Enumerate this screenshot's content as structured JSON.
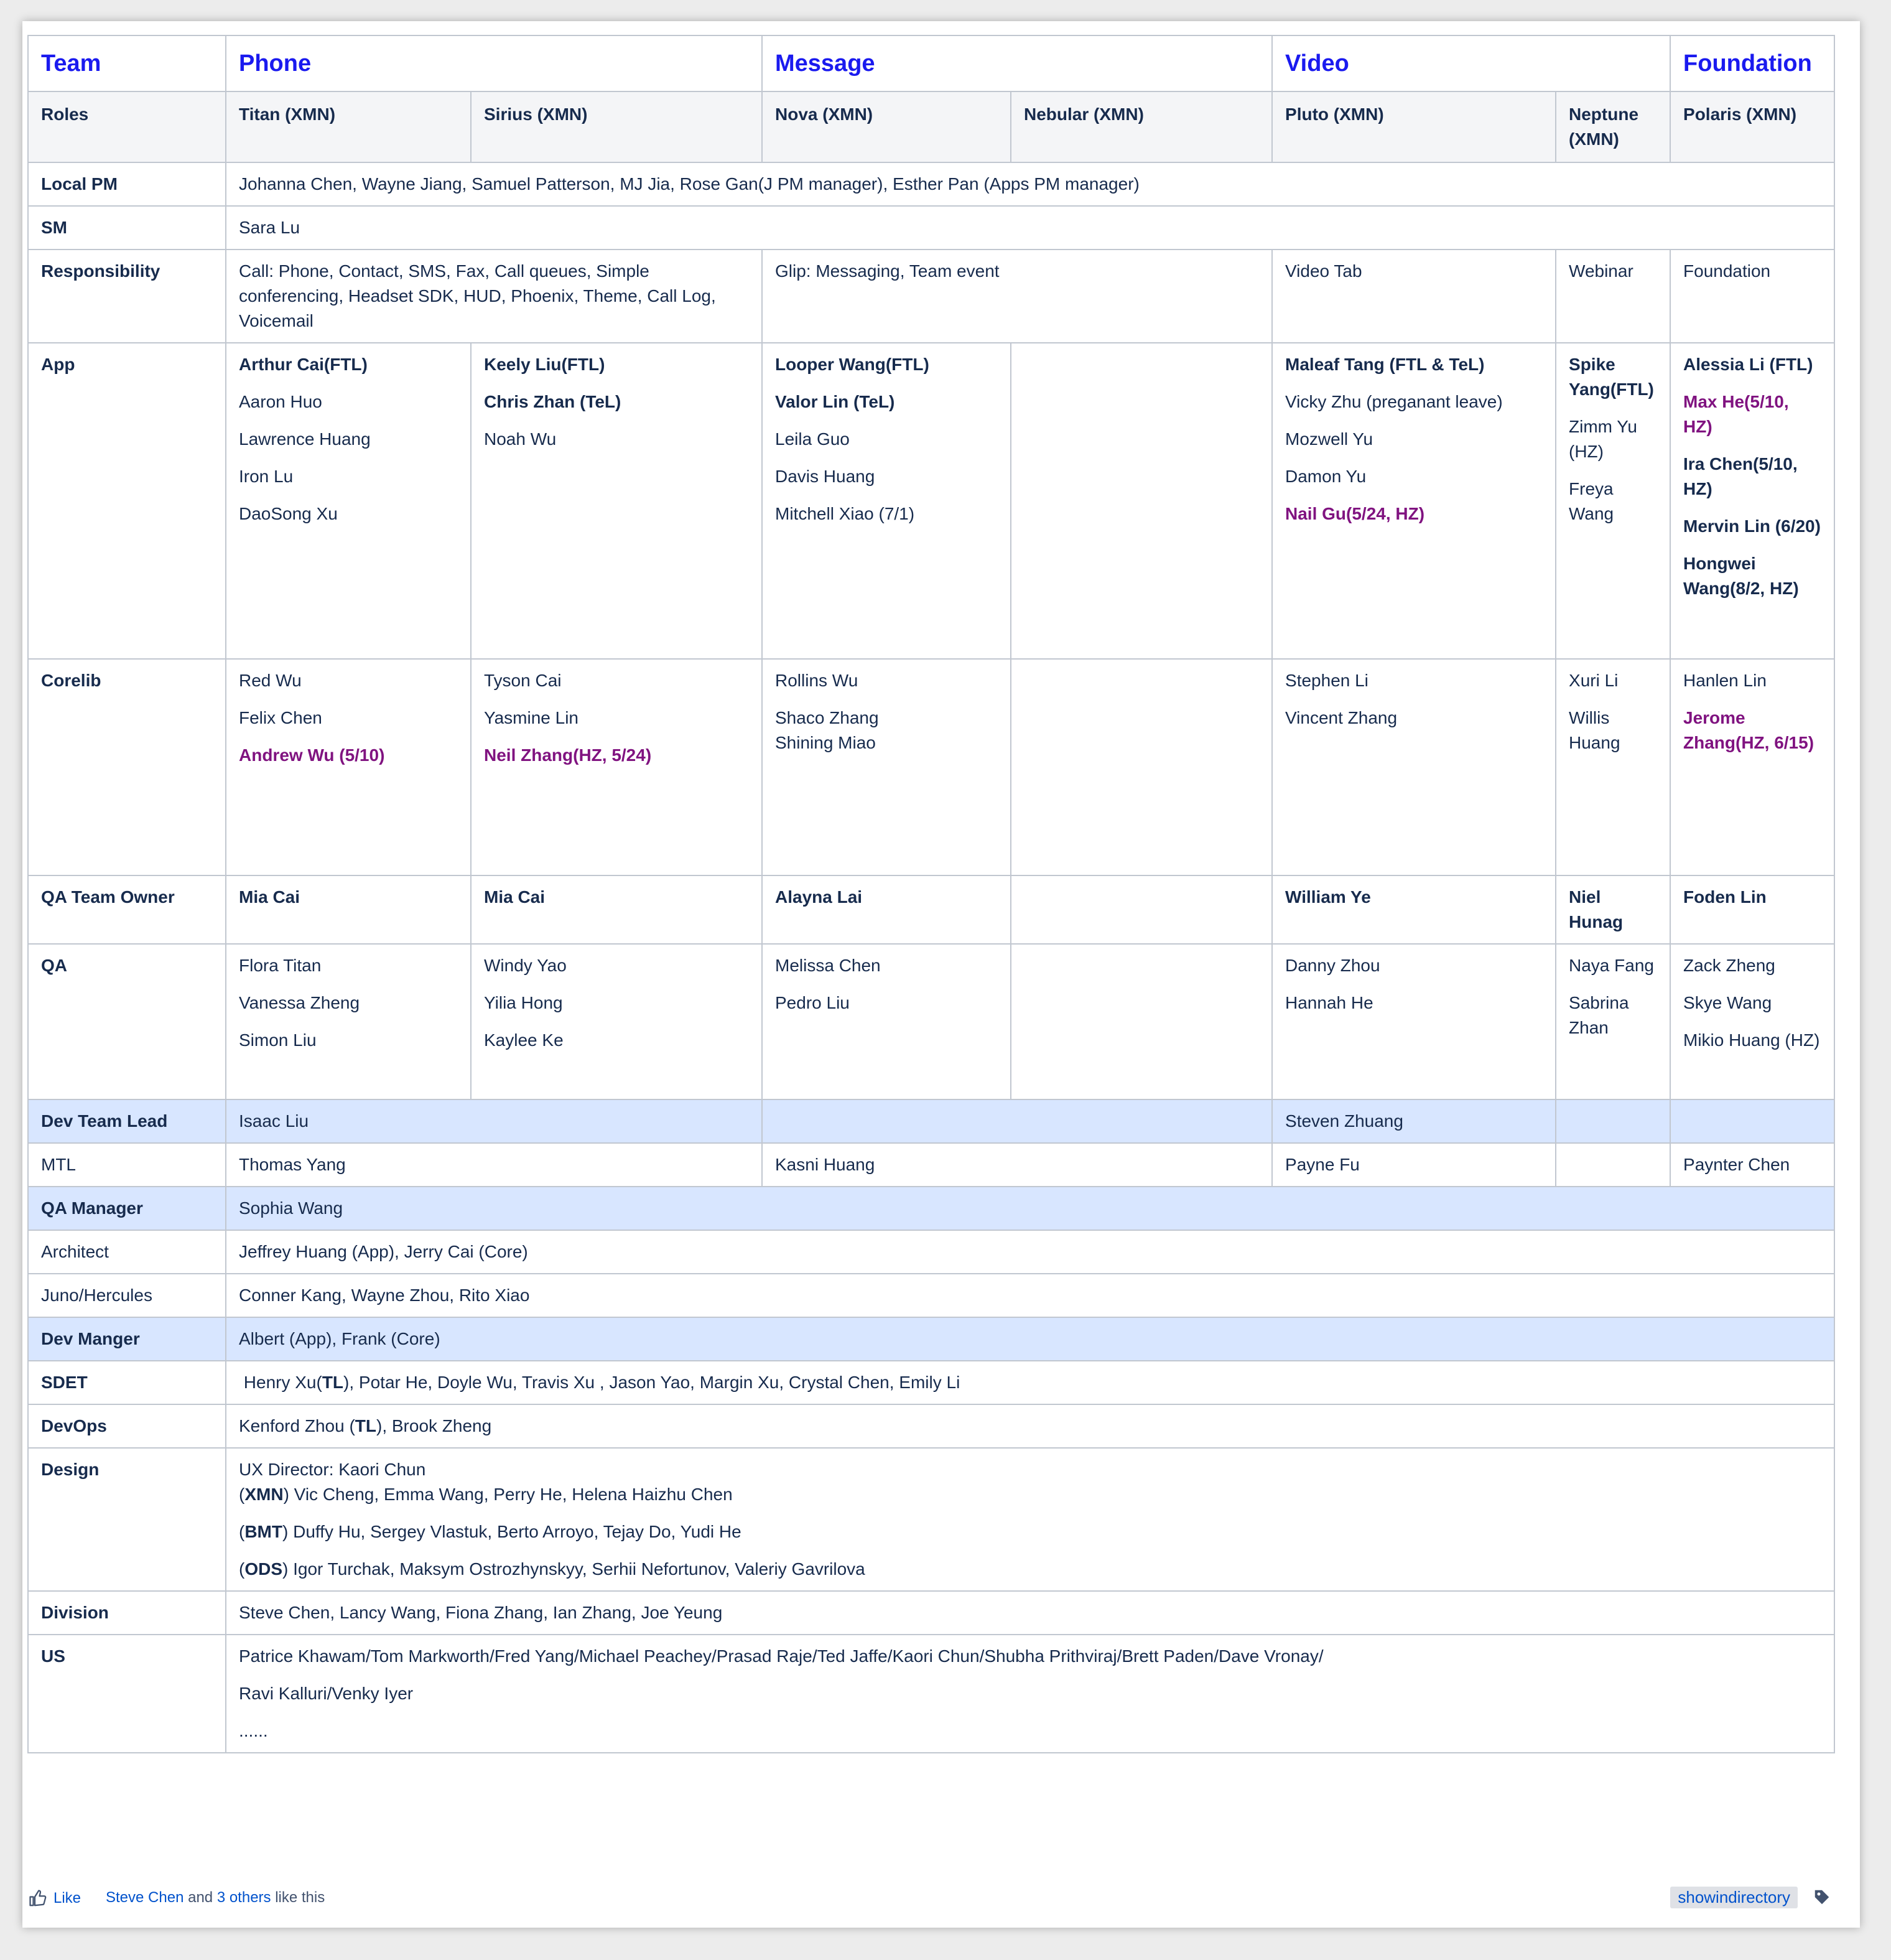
{
  "header": {
    "team_label": "Team",
    "phone": "Phone",
    "message": "Message",
    "video": "Video",
    "foundation": "Foundation"
  },
  "roles": {
    "label": "Roles",
    "titan": "Titan (XMN)",
    "sirius": "Sirius (XMN)",
    "nova": "Nova (XMN)",
    "nebular": "Nebular (XMN)",
    "pluto": "Pluto (XMN)",
    "neptune": "Neptune (XMN)",
    "polaris": "Polaris (XMN)"
  },
  "local_pm": {
    "label": "Local PM",
    "value": "Johanna Chen, Wayne Jiang, Samuel Patterson, MJ Jia, Rose Gan(J PM manager), Esther Pan (Apps PM manager)"
  },
  "sm": {
    "label": "SM",
    "value": "Sara Lu"
  },
  "responsibility": {
    "label": "Responsibility",
    "phone": "Call: Phone, Contact, SMS, Fax, Call queues, Simple conferencing, Headset SDK, HUD, Phoenix, Theme, Call Log, Voicemail",
    "message": "Glip: Messaging, Team event",
    "video": "Video Tab",
    "neptune": "Webinar",
    "foundation": "Foundation"
  },
  "app": {
    "label": "App",
    "titan": [
      "Arthur Cai(FTL)",
      "Aaron Huo",
      "Lawrence Huang",
      "Iron Lu",
      "DaoSong Xu"
    ],
    "sirius": [
      "Keely Liu(FTL)",
      "Chris Zhan (TeL)",
      "Noah Wu"
    ],
    "nova": [
      "Looper Wang(FTL)",
      "Valor Lin (TeL)",
      "Leila Guo",
      "Davis Huang",
      "Mitchell Xiao (7/1)"
    ],
    "pluto": [
      "Maleaf Tang (FTL & TeL)",
      "Vicky Zhu (preganant leave)",
      "Mozwell Yu",
      "Damon Yu",
      "Nail Gu(5/24, HZ)"
    ],
    "neptune": [
      "Spike Yang(FTL)",
      "Zimm Yu (HZ)",
      "Freya Wang"
    ],
    "polaris": [
      "Alessia Li (FTL)",
      "Max He(5/10, HZ)",
      "Ira Chen(5/10, HZ)",
      "Mervin Lin (6/20)",
      "Hongwei Wang(8/2, HZ)"
    ]
  },
  "corelib": {
    "label": "Corelib",
    "titan": [
      "Red Wu",
      "Felix Chen",
      "Andrew Wu (5/10)"
    ],
    "sirius": [
      "Tyson Cai",
      "Yasmine Lin",
      "Neil Zhang(HZ, 5/24)"
    ],
    "nova": [
      "Rollins Wu",
      "Shaco Zhang",
      "Shining Miao"
    ],
    "pluto": [
      "Stephen Li",
      "Vincent Zhang"
    ],
    "neptune": [
      "Xuri Li",
      "Willis Huang"
    ],
    "polaris": [
      "Hanlen Lin",
      "Jerome Zhang(HZ, 6/15)"
    ]
  },
  "qa_owner": {
    "label": "QA Team Owner",
    "titan": "Mia Cai",
    "sirius": "Mia Cai",
    "nova": "Alayna Lai",
    "pluto": "William Ye",
    "neptune": "Niel Hunag",
    "polaris": "Foden Lin"
  },
  "qa": {
    "label": "QA",
    "titan": [
      "Flora Titan",
      "Vanessa Zheng",
      "Simon Liu"
    ],
    "sirius": [
      "Windy Yao",
      "Yilia Hong",
      "Kaylee Ke"
    ],
    "nova": [
      "Melissa Chen",
      "Pedro Liu"
    ],
    "pluto": [
      "Danny Zhou",
      "Hannah He"
    ],
    "neptune": [
      "Naya Fang",
      "Sabrina Zhan"
    ],
    "polaris": [
      "Zack Zheng",
      "Skye Wang",
      "Mikio Huang (HZ)"
    ]
  },
  "dev_team_lead": {
    "label": "Dev Team Lead",
    "phone": "Isaac Liu",
    "video": "Steven Zhuang"
  },
  "mtl": {
    "label": "MTL",
    "phone": "Thomas Yang",
    "message": "Kasni Huang",
    "video": "Payne Fu",
    "foundation": "Paynter Chen"
  },
  "qa_manager": {
    "label": "QA Manager",
    "value": "Sophia Wang"
  },
  "architect": {
    "label": "Architect",
    "value": "Jeffrey Huang (App), Jerry Cai (Core)"
  },
  "juno": {
    "label": "Juno/Hercules",
    "value": "Conner Kang, Wayne Zhou, Rito Xiao"
  },
  "dev_manager": {
    "label": "Dev Manger",
    "value": "Albert (App), Frank (Core)"
  },
  "sdet": {
    "label": "SDET",
    "first": "Henry Xu(",
    "tl": "TL",
    "rest": "), Potar He, Doyle Wu, Travis Xu , Jason Yao, Margin Xu, Crystal Chen, Emily Li"
  },
  "devops": {
    "label": "DevOps",
    "first": "Kenford Zhou (",
    "tl": "TL",
    "rest": "), Brook Zheng"
  },
  "design": {
    "label": "Design",
    "director": "UX Director: Kaori Chun",
    "xmn_tag": "XMN",
    "xmn": " Vic Cheng, Emma Wang, Perry He, Helena Haizhu Chen",
    "bmt_tag": "BMT",
    "bmt": " Duffy Hu, Sergey Vlastuk, Berto Arroyo, Tejay Do, Yudi He",
    "ods_tag": "ODS",
    "ods": " Igor Turchak, Maksym Ostrozhynskyy, Serhii Nefortunov, Valeriy Gavrilova"
  },
  "division": {
    "label": "Division",
    "value": "Steve Chen, Lancy Wang, Fiona Zhang, Ian Zhang, Joe Yeung"
  },
  "us": {
    "label": "US",
    "line1": "Patrice Khawam/Tom Markworth/Fred Yang/Michael Peachey/Prasad Raje/Ted Jaffe/Kaori Chun/Shubha Prithviraj/Brett Paden/Dave Vronay/",
    "line2": "Ravi Kalluri/Venky Iyer",
    "line3": "......"
  },
  "footer": {
    "like": "Like",
    "likers": "Steve Chen",
    "and": " and ",
    "others": "3 others",
    "like_this": " like this",
    "label": "showindirectory"
  },
  "icons": {
    "like": "thumbs-up-icon",
    "tag": "tag-icon"
  },
  "colors": {
    "team_header": "#1a1aef",
    "new_member": "#801380",
    "highlight_row": "#d8e6ff"
  }
}
